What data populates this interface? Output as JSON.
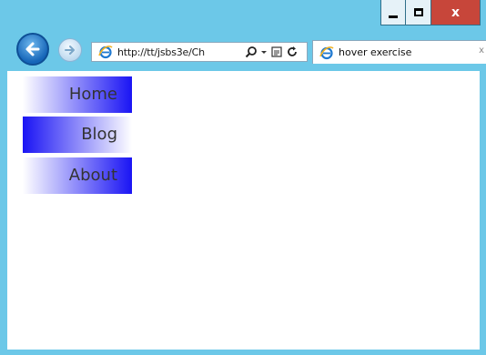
{
  "window_controls": {
    "minimize": "minimize-icon",
    "maximize": "maximize-icon",
    "close_label": "x"
  },
  "toolbar": {
    "back_icon": "back-arrow-icon",
    "forward_icon": "forward-arrow-icon",
    "address": "http://tt/jsbs3e/Ch",
    "address_icons": [
      "search-icon",
      "dropdown-icon",
      "compatibility-icon",
      "refresh-icon"
    ]
  },
  "tab": {
    "title": "hover exercise",
    "close_label": "x"
  },
  "menu": {
    "items": [
      {
        "label": "Home"
      },
      {
        "label": "Blog"
      },
      {
        "label": "About"
      }
    ]
  },
  "colors": {
    "menu_blue": "#1a14f4",
    "menu_text": "#333333",
    "frame": "#6cc8e8",
    "close_red": "#c7463a"
  }
}
